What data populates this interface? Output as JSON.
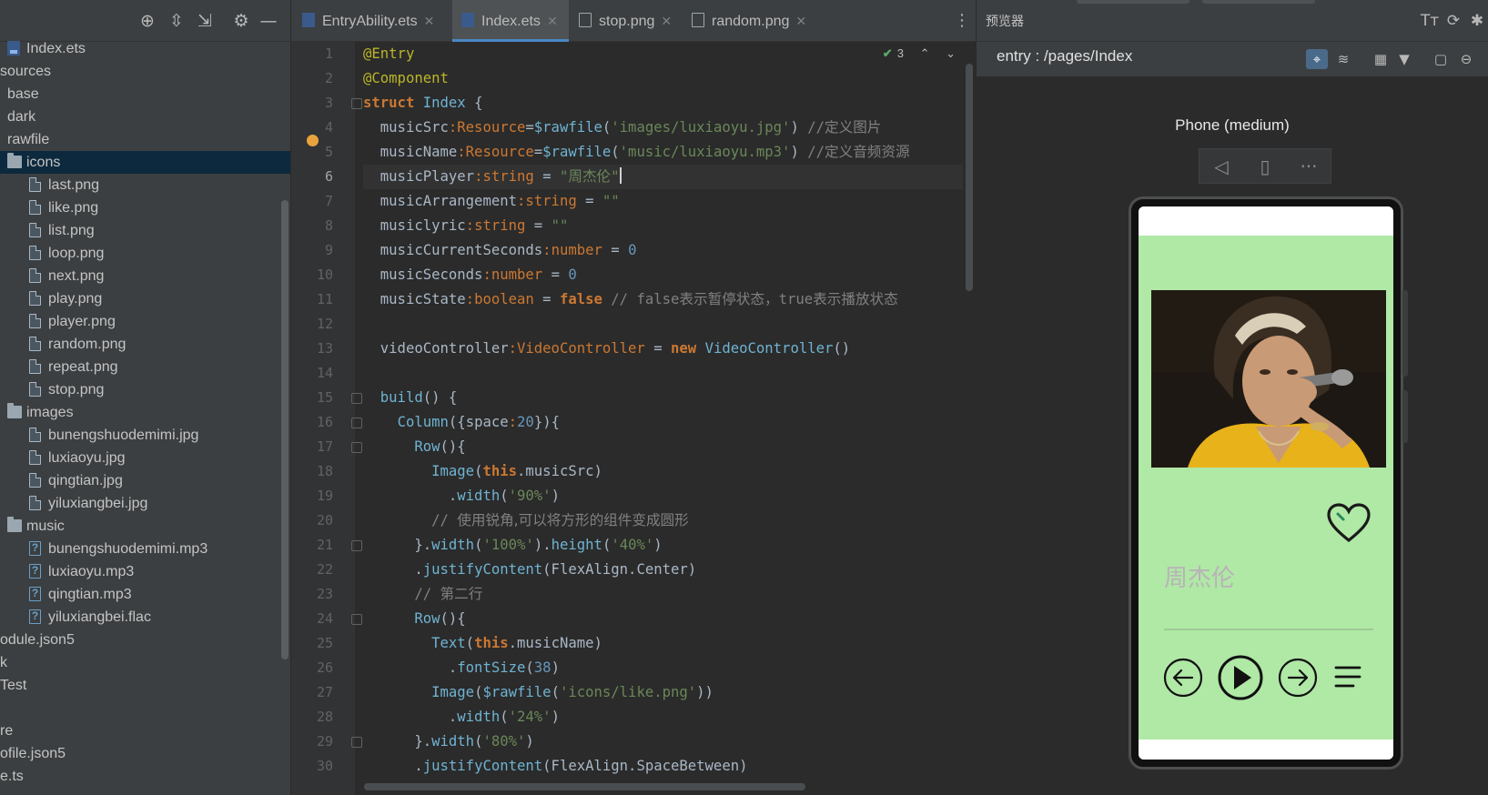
{
  "project": {
    "tree": [
      {
        "label": "Index.ets",
        "type": "ets",
        "indent": 8,
        "selected": false
      },
      {
        "label": "sources",
        "type": "none",
        "indent": 0,
        "selected": false
      },
      {
        "label": "base",
        "type": "partial-folder",
        "indent": 0,
        "selected": false
      },
      {
        "label": "dark",
        "type": "partial-folder",
        "indent": 0,
        "selected": false
      },
      {
        "label": "rawfile",
        "type": "partial-folder",
        "indent": 0,
        "selected": false
      },
      {
        "label": "icons",
        "type": "folder",
        "indent": 8,
        "selected": true
      },
      {
        "label": "last.png",
        "type": "file",
        "indent": 32,
        "selected": false
      },
      {
        "label": "like.png",
        "type": "file",
        "indent": 32,
        "selected": false
      },
      {
        "label": "list.png",
        "type": "file",
        "indent": 32,
        "selected": false
      },
      {
        "label": "loop.png",
        "type": "file",
        "indent": 32,
        "selected": false
      },
      {
        "label": "next.png",
        "type": "file",
        "indent": 32,
        "selected": false
      },
      {
        "label": "play.png",
        "type": "file",
        "indent": 32,
        "selected": false
      },
      {
        "label": "player.png",
        "type": "file",
        "indent": 32,
        "selected": false
      },
      {
        "label": "random.png",
        "type": "file",
        "indent": 32,
        "selected": false
      },
      {
        "label": "repeat.png",
        "type": "file",
        "indent": 32,
        "selected": false
      },
      {
        "label": "stop.png",
        "type": "file",
        "indent": 32,
        "selected": false
      },
      {
        "label": "images",
        "type": "folder",
        "indent": 8,
        "selected": false
      },
      {
        "label": "bunengshuodemimi.jpg",
        "type": "file",
        "indent": 32,
        "selected": false
      },
      {
        "label": "luxiaoyu.jpg",
        "type": "file",
        "indent": 32,
        "selected": false
      },
      {
        "label": "qingtian.jpg",
        "type": "file",
        "indent": 32,
        "selected": false
      },
      {
        "label": "yiluxiangbei.jpg",
        "type": "file",
        "indent": 32,
        "selected": false
      },
      {
        "label": "music",
        "type": "folder",
        "indent": 8,
        "selected": false
      },
      {
        "label": "bunengshuodemimi.mp3",
        "type": "audio",
        "indent": 32,
        "selected": false
      },
      {
        "label": "luxiaoyu.mp3",
        "type": "audio",
        "indent": 32,
        "selected": false
      },
      {
        "label": "qingtian.mp3",
        "type": "audio",
        "indent": 32,
        "selected": false
      },
      {
        "label": "yiluxiangbei.flac",
        "type": "audio",
        "indent": 32,
        "selected": false
      },
      {
        "label": "odule.json5",
        "type": "none",
        "indent": 0,
        "selected": false
      },
      {
        "label": "k",
        "type": "none",
        "indent": 0,
        "selected": false
      },
      {
        "label": "Test",
        "type": "none",
        "indent": 0,
        "selected": false
      },
      {
        "label": "",
        "type": "none",
        "indent": 0,
        "selected": false
      },
      {
        "label": "re",
        "type": "none",
        "indent": 0,
        "selected": false
      },
      {
        "label": "ofile.json5",
        "type": "none",
        "indent": 0,
        "selected": false
      },
      {
        "label": "e.ts",
        "type": "none",
        "indent": 0,
        "selected": false
      }
    ]
  },
  "tabs": [
    {
      "label": "EntryAbility.ets",
      "kind": "ets",
      "active": false
    },
    {
      "label": "Index.ets",
      "kind": "ets",
      "active": true
    },
    {
      "label": "stop.png",
      "kind": "png",
      "active": false
    },
    {
      "label": "random.png",
      "kind": "png",
      "active": false
    }
  ],
  "editor": {
    "current_line": 6,
    "inspection_count": "3",
    "line_numbers": [
      "1",
      "2",
      "3",
      "4",
      "5",
      "6",
      "7",
      "8",
      "9",
      "10",
      "11",
      "12",
      "13",
      "14",
      "15",
      "16",
      "17",
      "18",
      "19",
      "20",
      "21",
      "22",
      "23",
      "24",
      "25",
      "26",
      "27",
      "28",
      "29",
      "30"
    ]
  },
  "previewer": {
    "title": "预览器",
    "route": "entry : /pages/Index",
    "device": "Phone (medium)",
    "app": {
      "song_title": "周杰伦"
    }
  },
  "colors": {
    "screen_bg": "#b0e8a6",
    "selection": "#0d293e",
    "accent": "#4a88c7"
  }
}
